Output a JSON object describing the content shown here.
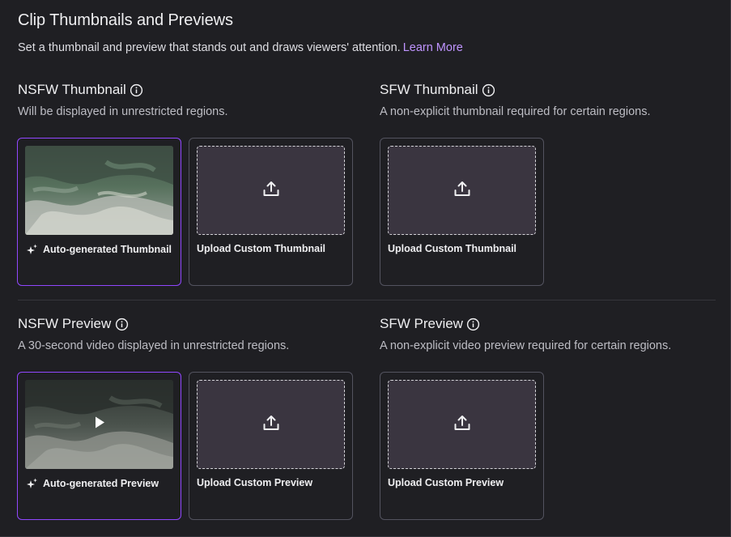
{
  "header": {
    "title": "Clip Thumbnails and Previews",
    "description": "Set a thumbnail and preview that stands out and draws viewers' attention.",
    "learn_more": "Learn More"
  },
  "nsfw_thumbnail": {
    "title": "NSFW Thumbnail",
    "subtitle": "Will be displayed in unrestricted regions.",
    "auto_label": "Auto-generated Thumbnail",
    "upload_label": "Upload Custom Thumbnail"
  },
  "sfw_thumbnail": {
    "title": "SFW Thumbnail",
    "subtitle": "A non-explicit thumbnail required for certain regions.",
    "upload_label": "Upload Custom Thumbnail"
  },
  "nsfw_preview": {
    "title": "NSFW Preview",
    "subtitle": "A 30-second video displayed in unrestricted regions.",
    "auto_label": "Auto-generated Preview",
    "upload_label": "Upload Custom Preview"
  },
  "sfw_preview": {
    "title": "SFW Preview",
    "subtitle": "A non-explicit video preview required for certain regions.",
    "upload_label": "Upload Custom Preview"
  },
  "icons": {
    "info": "info-icon",
    "sparkle": "sparkle-icon",
    "upload": "upload-icon",
    "play": "play-icon"
  },
  "colors": {
    "accent": "#9147ff",
    "link": "#bf94ff",
    "background": "#1f1f23"
  }
}
